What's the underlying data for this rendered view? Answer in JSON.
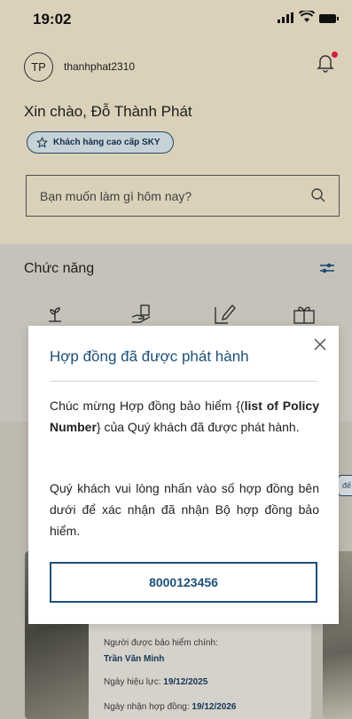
{
  "status_bar": {
    "time": "19:02"
  },
  "header": {
    "avatar_initials": "TP",
    "username": "thanhphat2310",
    "greeting": "Xin chào, Đỗ Thành Phát",
    "badge_label": "Khách hàng cao cấp SKY"
  },
  "search": {
    "placeholder": "Bạn muốn làm gì hôm nay?"
  },
  "functions": {
    "title": "Chức năng",
    "icons": [
      "plant-hand-icon",
      "hand-document-icon",
      "edit-document-icon",
      "gift-icon"
    ]
  },
  "contract_card": {
    "insured_label": "Người được bảo hiểm chính:",
    "insured_name": "Trần Văn Minh",
    "effective_label": "Ngày hiệu lực: ",
    "effective_date": "19/12/2025",
    "received_label": "Ngày nhận hợp đồng: ",
    "received_date": "19/12/2026"
  },
  "side": {
    "tag_text": "đế"
  },
  "modal": {
    "title": "Hợp đồng đã được phát hành",
    "para1_a": "Chúc mừng Hợp đồng bảo hiểm {(",
    "para1_bold": "list of Policy Number",
    "para1_b": "} của Quý khách đã được phát hành.",
    "para2": "Quý khách vui lòng nhấn vào số hợp đồng bên dưới để xác nhận đã nhận Bộ hợp đồng bảo hiểm.",
    "policy_number": "8000123456"
  },
  "colors": {
    "header_bg": "#e9dfc6",
    "accent": "#1d4f78",
    "notification_dot": "#e1253f"
  }
}
